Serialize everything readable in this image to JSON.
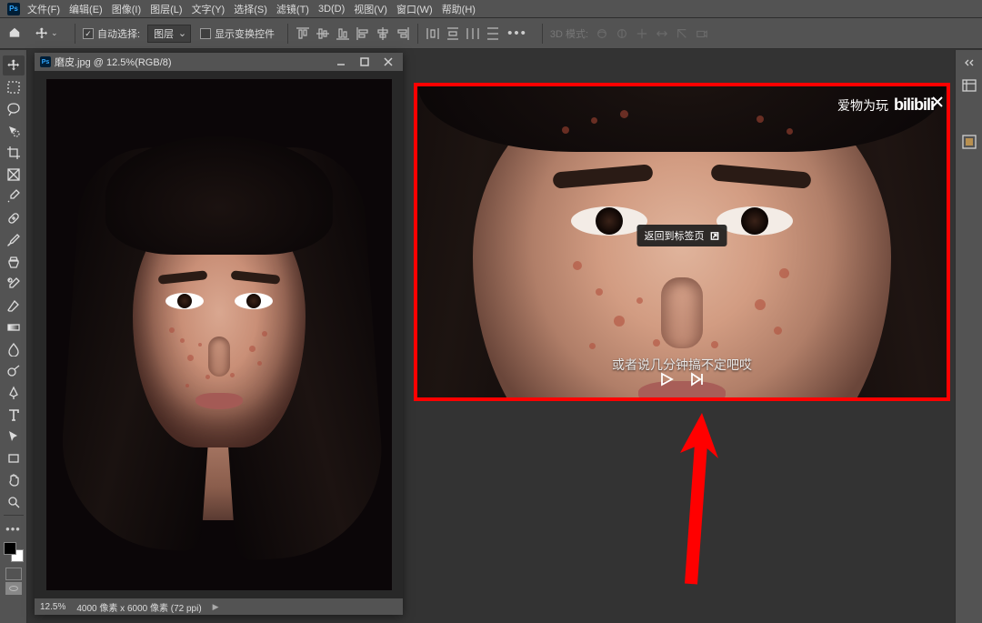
{
  "menu": {
    "items": [
      "文件(F)",
      "编辑(E)",
      "图像(I)",
      "图层(L)",
      "文字(Y)",
      "选择(S)",
      "滤镜(T)",
      "3D(D)",
      "视图(V)",
      "窗口(W)",
      "帮助(H)"
    ]
  },
  "options": {
    "auto_select_label": "自动选择:",
    "auto_select_value": "图层",
    "show_transform_label": "显示变换控件",
    "mode3d_label": "3D 模式:"
  },
  "document": {
    "title": "磨皮.jpg @ 12.5%(RGB/8)",
    "zoom": "12.5%",
    "dimensions": "4000 像素 x 6000 像素 (72 ppi)"
  },
  "overlay": {
    "brand_text": "爱物为玩",
    "brand_logo": "bilibili",
    "tooltip": "返回到标签页",
    "caption": "或者说几分钟搞不定吧哎"
  },
  "tools": [
    "move",
    "artboard",
    "marquee",
    "lasso",
    "quick-select",
    "crop",
    "frame",
    "eyedropper",
    "spot-heal",
    "brush",
    "clone",
    "history-brush",
    "eraser",
    "gradient",
    "blur",
    "dodge",
    "pen",
    "type",
    "path-select",
    "rectangle",
    "hand",
    "zoom"
  ]
}
